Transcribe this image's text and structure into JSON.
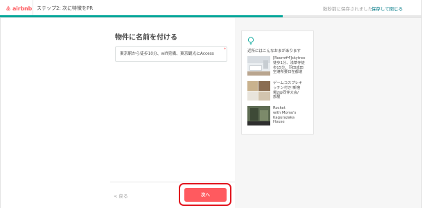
{
  "header": {
    "logo_text": "airbnb",
    "step_title": "ステップ2: 次に特徴をPR",
    "save_status": "数秒前に保存されました -",
    "save_link": "保存して閉じる"
  },
  "progress": {
    "fraction": 0.67,
    "color": "#00A699"
  },
  "form": {
    "title": "物件に名前を付ける",
    "input_value": "東京駅から徒歩10分、wifi完備、東京観光にAccess",
    "required_mark": "*"
  },
  "footer": {
    "back_label": "< 戻る",
    "next_label": "次へ"
  },
  "tips": {
    "heading": "近所にはこんなおまがあります",
    "items": [
      {
        "text": "[Room#4]skytree\n徒歩1分、浅草寺徒\n歩15分、羽田成田\n空港所要日在都道",
        "thumb": "room-photo"
      },
      {
        "text": "ゲームコスプレキ\nッチン付き!新宿\n場2@同伴大会/\n部屋",
        "thumb": "kitchen-photo"
      },
      {
        "text": "Rocket\nwith Momo's\nKagurazaka\nHouse",
        "thumb": "house-photo"
      }
    ]
  },
  "colors": {
    "brand": "#FF5A5F",
    "accent": "#007A87",
    "highlight": "#e1141e"
  },
  "icons": [
    "airbnb-logo-icon",
    "lightbulb-icon"
  ]
}
